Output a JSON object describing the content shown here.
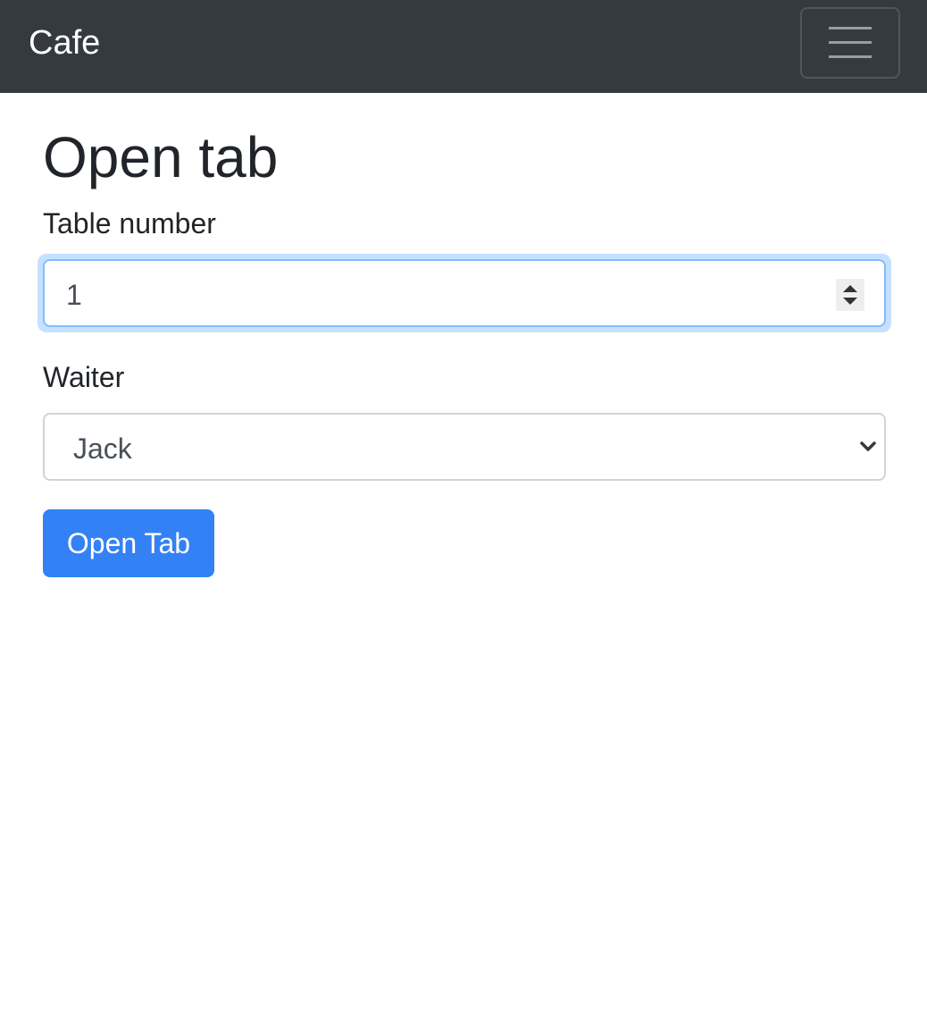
{
  "navbar": {
    "brand": "Cafe",
    "toggler_icon": "hamburger-menu-icon",
    "background": "#343a40"
  },
  "form": {
    "title": "Open tab",
    "table_number": {
      "label": "Table number",
      "value": "1"
    },
    "waiter": {
      "label": "Waiter",
      "selected": "Jack"
    },
    "submit_label": "Open Tab"
  },
  "colors": {
    "primary": "#3481f6",
    "focus_border": "#80bdff",
    "text": "#212529"
  }
}
